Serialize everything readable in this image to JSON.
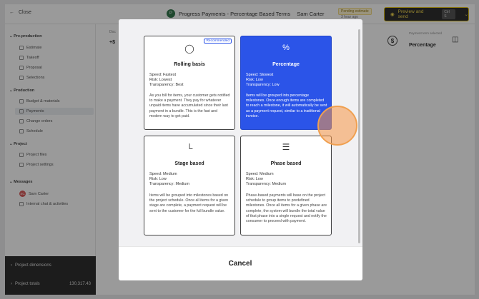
{
  "topbar": {
    "close_label": "Close",
    "title_icon": "P",
    "title": "Progress Payments - Percentage Based Terms",
    "customer": "Sam Carter",
    "status_badge": "Pending estimate",
    "status_sub": "3 hour ago",
    "preview_label": "Preview and send",
    "shortcut": "Ctrl S"
  },
  "sidebar": {
    "sections": [
      {
        "label": "Pre-production",
        "items": [
          "Estimate",
          "Takeoff",
          "Proposal",
          "Selections"
        ]
      },
      {
        "label": "Production",
        "items": [
          "Budget & materials",
          "Payments",
          "Change orders",
          "Schedule"
        ]
      },
      {
        "label": "Project",
        "items": [
          "Project files",
          "Project settings"
        ]
      },
      {
        "label": "Messages",
        "items": [
          "Sam Carter",
          "Internal chat & activities"
        ]
      }
    ],
    "avatar_initials": "SC",
    "active_item": "Payments",
    "footer": {
      "dimensions_label": "Project dimensions",
      "totals_label": "Project totals",
      "totals_value": "130,317.43"
    }
  },
  "background": {
    "stat_label": "Doc",
    "stat_value": "+$",
    "right_card_label": "Payment term selected",
    "right_card_value": "Percentage"
  },
  "modal": {
    "cards": [
      {
        "title": "Rolling basis",
        "icon": "coin-icon",
        "badge": "Recommended",
        "speed": "Speed: Fastest",
        "risk": "Risk: Lowest",
        "transparency": "Transparency: Best",
        "description": "As you bill for items, your customer gets notified to make a payment. They pay for whatever unpaid items have accumulated since their last payment in a bundle. This is the fast and modern way to get paid."
      },
      {
        "title": "Percentage",
        "icon": "percent-icon",
        "speed": "Speed: Slowest",
        "risk": "Risk: Low",
        "transparency": "Transparency: Low",
        "description": "Items will be grouped into percentage milestones. Once enough items are completed to reach a milestone, it will automatically be sent as a payment request, similar to a traditional invoice."
      },
      {
        "title": "Stage based",
        "icon": "stages-icon",
        "speed": "Speed: Medium",
        "risk": "Risk: Low",
        "transparency": "Transparency: Medium",
        "description": "Items will be grouped into milestones based on the project schedule. Once all items for a given stage are complete, a payment request will be sent to the customer for the full bundle value."
      },
      {
        "title": "Phase based",
        "icon": "menu-lines-icon",
        "speed": "Speed: Medium",
        "risk": "Risk: Low",
        "transparency": "Transparency: Medium",
        "description": "Phase-based payments will base on the project schedule to group items to predefined milestones. Once all items for a given phase are complete, the system will bundle the total value of that phase into a single request and notify the consumer to proceed with payment."
      }
    ],
    "cancel_label": "Cancel"
  }
}
